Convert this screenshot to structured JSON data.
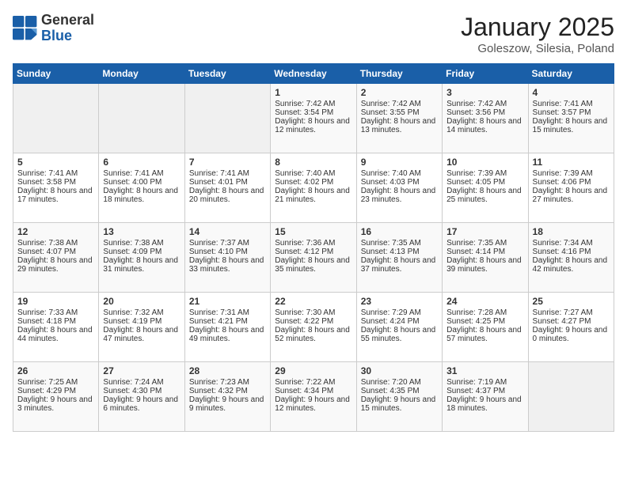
{
  "header": {
    "logo": {
      "general": "General",
      "blue": "Blue"
    },
    "title": "January 2025",
    "location": "Goleszow, Silesia, Poland"
  },
  "days_of_week": [
    "Sunday",
    "Monday",
    "Tuesday",
    "Wednesday",
    "Thursday",
    "Friday",
    "Saturday"
  ],
  "weeks": [
    [
      {
        "day": "",
        "empty": true
      },
      {
        "day": "",
        "empty": true
      },
      {
        "day": "",
        "empty": true
      },
      {
        "day": "1",
        "sunrise": "Sunrise: 7:42 AM",
        "sunset": "Sunset: 3:54 PM",
        "daylight": "Daylight: 8 hours and 12 minutes."
      },
      {
        "day": "2",
        "sunrise": "Sunrise: 7:42 AM",
        "sunset": "Sunset: 3:55 PM",
        "daylight": "Daylight: 8 hours and 13 minutes."
      },
      {
        "day": "3",
        "sunrise": "Sunrise: 7:42 AM",
        "sunset": "Sunset: 3:56 PM",
        "daylight": "Daylight: 8 hours and 14 minutes."
      },
      {
        "day": "4",
        "sunrise": "Sunrise: 7:41 AM",
        "sunset": "Sunset: 3:57 PM",
        "daylight": "Daylight: 8 hours and 15 minutes."
      }
    ],
    [
      {
        "day": "5",
        "sunrise": "Sunrise: 7:41 AM",
        "sunset": "Sunset: 3:58 PM",
        "daylight": "Daylight: 8 hours and 17 minutes."
      },
      {
        "day": "6",
        "sunrise": "Sunrise: 7:41 AM",
        "sunset": "Sunset: 4:00 PM",
        "daylight": "Daylight: 8 hours and 18 minutes."
      },
      {
        "day": "7",
        "sunrise": "Sunrise: 7:41 AM",
        "sunset": "Sunset: 4:01 PM",
        "daylight": "Daylight: 8 hours and 20 minutes."
      },
      {
        "day": "8",
        "sunrise": "Sunrise: 7:40 AM",
        "sunset": "Sunset: 4:02 PM",
        "daylight": "Daylight: 8 hours and 21 minutes."
      },
      {
        "day": "9",
        "sunrise": "Sunrise: 7:40 AM",
        "sunset": "Sunset: 4:03 PM",
        "daylight": "Daylight: 8 hours and 23 minutes."
      },
      {
        "day": "10",
        "sunrise": "Sunrise: 7:39 AM",
        "sunset": "Sunset: 4:05 PM",
        "daylight": "Daylight: 8 hours and 25 minutes."
      },
      {
        "day": "11",
        "sunrise": "Sunrise: 7:39 AM",
        "sunset": "Sunset: 4:06 PM",
        "daylight": "Daylight: 8 hours and 27 minutes."
      }
    ],
    [
      {
        "day": "12",
        "sunrise": "Sunrise: 7:38 AM",
        "sunset": "Sunset: 4:07 PM",
        "daylight": "Daylight: 8 hours and 29 minutes."
      },
      {
        "day": "13",
        "sunrise": "Sunrise: 7:38 AM",
        "sunset": "Sunset: 4:09 PM",
        "daylight": "Daylight: 8 hours and 31 minutes."
      },
      {
        "day": "14",
        "sunrise": "Sunrise: 7:37 AM",
        "sunset": "Sunset: 4:10 PM",
        "daylight": "Daylight: 8 hours and 33 minutes."
      },
      {
        "day": "15",
        "sunrise": "Sunrise: 7:36 AM",
        "sunset": "Sunset: 4:12 PM",
        "daylight": "Daylight: 8 hours and 35 minutes."
      },
      {
        "day": "16",
        "sunrise": "Sunrise: 7:35 AM",
        "sunset": "Sunset: 4:13 PM",
        "daylight": "Daylight: 8 hours and 37 minutes."
      },
      {
        "day": "17",
        "sunrise": "Sunrise: 7:35 AM",
        "sunset": "Sunset: 4:14 PM",
        "daylight": "Daylight: 8 hours and 39 minutes."
      },
      {
        "day": "18",
        "sunrise": "Sunrise: 7:34 AM",
        "sunset": "Sunset: 4:16 PM",
        "daylight": "Daylight: 8 hours and 42 minutes."
      }
    ],
    [
      {
        "day": "19",
        "sunrise": "Sunrise: 7:33 AM",
        "sunset": "Sunset: 4:18 PM",
        "daylight": "Daylight: 8 hours and 44 minutes."
      },
      {
        "day": "20",
        "sunrise": "Sunrise: 7:32 AM",
        "sunset": "Sunset: 4:19 PM",
        "daylight": "Daylight: 8 hours and 47 minutes."
      },
      {
        "day": "21",
        "sunrise": "Sunrise: 7:31 AM",
        "sunset": "Sunset: 4:21 PM",
        "daylight": "Daylight: 8 hours and 49 minutes."
      },
      {
        "day": "22",
        "sunrise": "Sunrise: 7:30 AM",
        "sunset": "Sunset: 4:22 PM",
        "daylight": "Daylight: 8 hours and 52 minutes."
      },
      {
        "day": "23",
        "sunrise": "Sunrise: 7:29 AM",
        "sunset": "Sunset: 4:24 PM",
        "daylight": "Daylight: 8 hours and 55 minutes."
      },
      {
        "day": "24",
        "sunrise": "Sunrise: 7:28 AM",
        "sunset": "Sunset: 4:25 PM",
        "daylight": "Daylight: 8 hours and 57 minutes."
      },
      {
        "day": "25",
        "sunrise": "Sunrise: 7:27 AM",
        "sunset": "Sunset: 4:27 PM",
        "daylight": "Daylight: 9 hours and 0 minutes."
      }
    ],
    [
      {
        "day": "26",
        "sunrise": "Sunrise: 7:25 AM",
        "sunset": "Sunset: 4:29 PM",
        "daylight": "Daylight: 9 hours and 3 minutes."
      },
      {
        "day": "27",
        "sunrise": "Sunrise: 7:24 AM",
        "sunset": "Sunset: 4:30 PM",
        "daylight": "Daylight: 9 hours and 6 minutes."
      },
      {
        "day": "28",
        "sunrise": "Sunrise: 7:23 AM",
        "sunset": "Sunset: 4:32 PM",
        "daylight": "Daylight: 9 hours and 9 minutes."
      },
      {
        "day": "29",
        "sunrise": "Sunrise: 7:22 AM",
        "sunset": "Sunset: 4:34 PM",
        "daylight": "Daylight: 9 hours and 12 minutes."
      },
      {
        "day": "30",
        "sunrise": "Sunrise: 7:20 AM",
        "sunset": "Sunset: 4:35 PM",
        "daylight": "Daylight: 9 hours and 15 minutes."
      },
      {
        "day": "31",
        "sunrise": "Sunrise: 7:19 AM",
        "sunset": "Sunset: 4:37 PM",
        "daylight": "Daylight: 9 hours and 18 minutes."
      },
      {
        "day": "",
        "empty": true
      }
    ]
  ]
}
